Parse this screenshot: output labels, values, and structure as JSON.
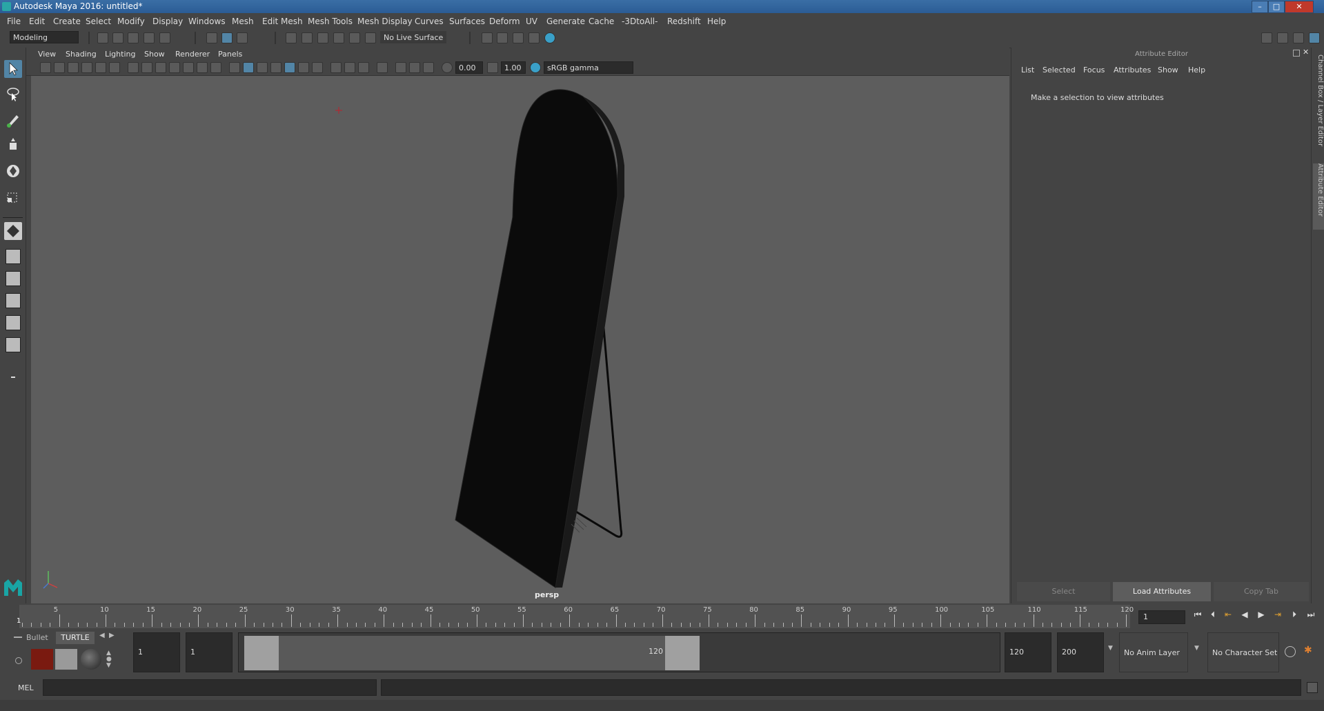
{
  "window": {
    "title": "Autodesk Maya 2016: untitled*"
  },
  "menubar": [
    "File",
    "Edit",
    "Create",
    "Select",
    "Modify",
    "Display",
    "Windows",
    "Mesh",
    "Edit Mesh",
    "Mesh Tools",
    "Mesh Display",
    "Curves",
    "Surfaces",
    "Deform",
    "UV",
    "Generate",
    "Cache",
    "-3DtoAll-",
    "Redshift",
    "Help"
  ],
  "toolbar": {
    "mode": "Modeling",
    "live_surface": "No Live Surface"
  },
  "viewport": {
    "menu": [
      "View",
      "Shading",
      "Lighting",
      "Show",
      "Renderer",
      "Panels"
    ],
    "exposure": "0.00",
    "gamma": "1.00",
    "color_space": "sRGB gamma",
    "camera_label": "persp"
  },
  "attribute_editor": {
    "title": "Attribute Editor",
    "menu": [
      "List",
      "Selected",
      "Focus",
      "Attributes",
      "Show",
      "Help"
    ],
    "message": "Make a selection to view attributes",
    "buttons": {
      "select": "Select",
      "load": "Load Attributes",
      "copy": "Copy Tab"
    }
  },
  "side_tabs": {
    "channel_box": "Channel Box / Layer Editor",
    "attribute_editor": "Attribute Editor"
  },
  "timeline": {
    "ticks": [
      "5",
      "10",
      "15",
      "20",
      "25",
      "30",
      "35",
      "40",
      "45",
      "50",
      "55",
      "60",
      "65",
      "70",
      "75",
      "80",
      "85",
      "90",
      "95",
      "100",
      "105",
      "110",
      "115",
      "120"
    ],
    "start_marker": "1",
    "current_frame": "1"
  },
  "range": {
    "shelf_tabs": [
      "Bullet",
      "TURTLE"
    ],
    "start": "1",
    "playback_start": "1",
    "slider_start": "1",
    "slider_end": "120",
    "playback_end": "120",
    "end": "200",
    "anim_layer": "No Anim Layer",
    "character_set": "No Character Set"
  },
  "command_line": {
    "label": "MEL"
  },
  "colors": {
    "viewport_bg": "#5d5d5d",
    "selected_tool": "#5285a6",
    "title_bar": "#2b5c95"
  }
}
